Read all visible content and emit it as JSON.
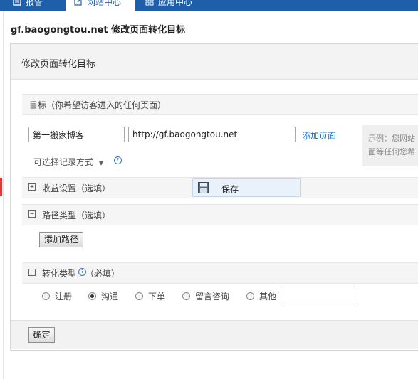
{
  "nav": {
    "tabs": [
      {
        "label": "报告"
      },
      {
        "label": "网站中心"
      },
      {
        "label": "应用中心"
      }
    ]
  },
  "page": {
    "heading": "gf.baogongtou.net 修改页面转化目标",
    "panel_title": "修改页面转化目标"
  },
  "target": {
    "section_label": "目标（你希望访客进入的任何页面）",
    "name_value": "第一搬家博客",
    "url_value": "http://gf.baogongtou.net",
    "add_page_link": "添加页面",
    "hint_line1": "示例：您网站",
    "hint_line2": "面等任何您希",
    "record_mode_label": "可选择记录方式"
  },
  "revenue": {
    "label": "收益设置（选填）",
    "save_label": "保存"
  },
  "path": {
    "label": "路径类型（选填）",
    "add_path_button": "添加路径"
  },
  "conversion": {
    "label": "转化类型",
    "required": "（必填）",
    "options": [
      {
        "label": "注册",
        "selected": false
      },
      {
        "label": "沟通",
        "selected": true
      },
      {
        "label": "下单",
        "selected": false
      },
      {
        "label": "留言咨询",
        "selected": false
      },
      {
        "label": "其他",
        "selected": false
      }
    ],
    "other_value": ""
  },
  "footer": {
    "confirm_button": "确定"
  },
  "colors": {
    "nav_blue": "#1f5ea8",
    "link_blue": "#1a66b5",
    "left_marker": "#e4393c"
  }
}
